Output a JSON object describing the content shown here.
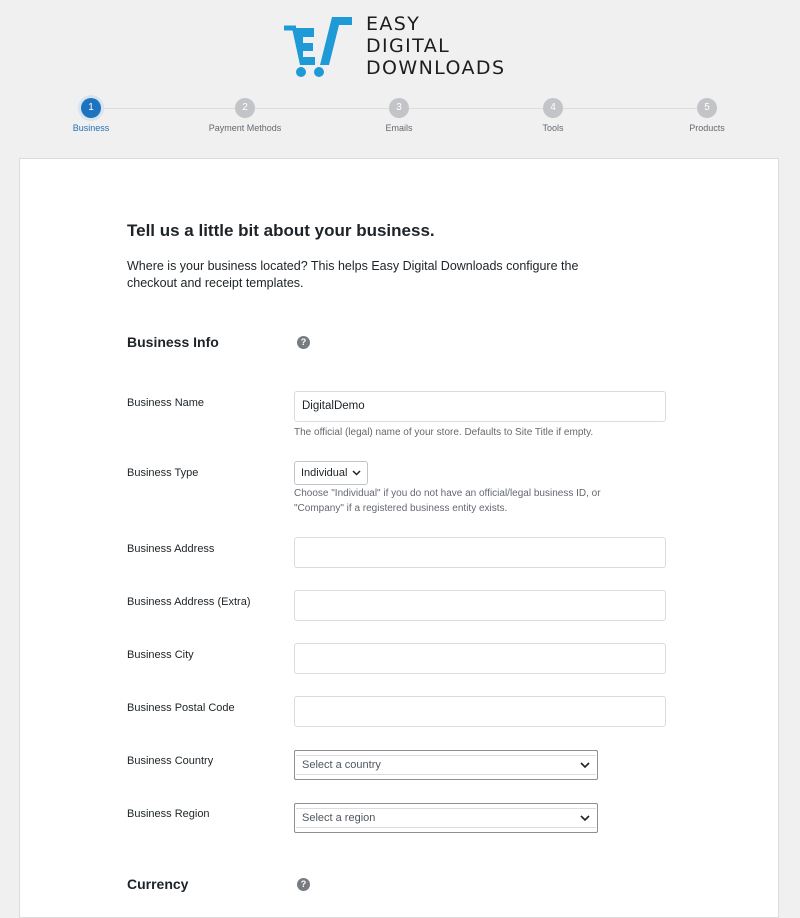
{
  "brand": {
    "line1": "EASY",
    "line2": "DIGITAL",
    "line3": "DOWNLOADS",
    "icon": "edd-cart-logo-icon",
    "color": "#1e9bd7"
  },
  "steps": [
    {
      "number": "1",
      "label": "Business",
      "active": true
    },
    {
      "number": "2",
      "label": "Payment Methods",
      "active": false
    },
    {
      "number": "3",
      "label": "Emails",
      "active": false
    },
    {
      "number": "4",
      "label": "Tools",
      "active": false
    },
    {
      "number": "5",
      "label": "Products",
      "active": false
    }
  ],
  "page": {
    "title": "Tell us a little bit about your business.",
    "intro": "Where is your business located? This helps Easy Digital Downloads configure the checkout and receipt templates."
  },
  "business_info": {
    "heading": "Business Info",
    "help_icon": "question-mark-icon"
  },
  "fields": {
    "business_name": {
      "label": "Business Name",
      "value": "DigitalDemo",
      "description": "The official (legal) name of your store. Defaults to Site Title if empty."
    },
    "business_type": {
      "label": "Business Type",
      "value": "Individual",
      "description": "Choose \"Individual\" if you do not have an official/legal business ID, or \"Company\" if a registered business entity exists."
    },
    "business_address": {
      "label": "Business Address",
      "value": ""
    },
    "business_address_extra": {
      "label": "Business Address (Extra)",
      "value": ""
    },
    "business_city": {
      "label": "Business City",
      "value": ""
    },
    "business_postal_code": {
      "label": "Business Postal Code",
      "value": ""
    },
    "business_country": {
      "label": "Business Country",
      "placeholder": "Select a country"
    },
    "business_region": {
      "label": "Business Region",
      "placeholder": "Select a region"
    }
  },
  "currency": {
    "heading": "Currency",
    "help_icon": "question-mark-icon"
  },
  "colors": {
    "accent": "#2271b1",
    "background": "#f0f0f1"
  }
}
